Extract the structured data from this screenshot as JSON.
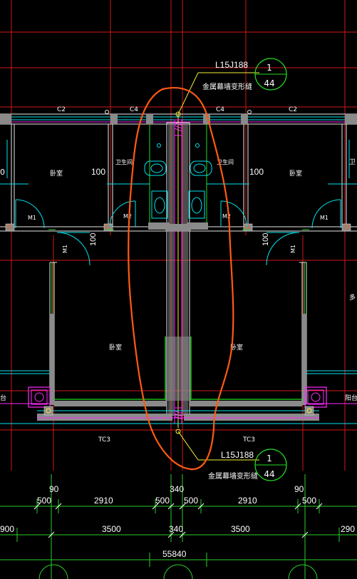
{
  "drawing": {
    "background": "#000000",
    "colors": {
      "axis_red": "#d01818",
      "wall_white": "#e8e8e8",
      "cyan": "#00e5ee",
      "green": "#22dd22",
      "magenta": "#ff2aff",
      "yellow": "#f5f03a",
      "gray_fill": "#8a8a8a",
      "orange_markup": "#ff5a14",
      "dim_green": "#2ad02a",
      "text_white": "#ffffff"
    },
    "top_callout": {
      "ref": "L15J188",
      "circle_top": "1",
      "circle_bottom": "44",
      "label": "金属幕墙变形缝"
    },
    "bottom_callout": {
      "ref": "L15J188",
      "circle_top": "1",
      "circle_bottom": "44",
      "label": "金属幕墙变形缝"
    },
    "window_labels": {
      "c2_left": "C2",
      "c4_left": "C4",
      "c4_right": "C4",
      "c2_right": "C2",
      "tc3_left": "TC3",
      "tc3_right": "TC3"
    },
    "room_labels": {
      "bedroom_tl": "卧室",
      "bedroom_tr": "卧室",
      "bath_left": "卫生间",
      "bath_right": "卫生间",
      "bedroom_ml": "卧室",
      "bedroom_mr": "卧室",
      "balcony_l": "台",
      "balcony_r": "阳台",
      "edge_tl": "0",
      "edge_tr": "卫",
      "edge_mr": "多"
    },
    "door_labels": {
      "m1_left": "M1",
      "m2_left": "M2",
      "m2_right": "M2",
      "m1_right": "M1",
      "m1_vert_left": "M1",
      "m1_vert_right": "M1"
    },
    "misc_dims": {
      "d100_l": "100",
      "d100_r": "100",
      "d100_vl": "100",
      "d100_vr": "100"
    },
    "dimensions": {
      "row1": [
        "90",
        "340",
        "90"
      ],
      "row2": [
        "500",
        "2910",
        "500",
        "500",
        "2910",
        "500"
      ],
      "row3": [
        "900",
        "3500",
        "340",
        "3500",
        "290"
      ],
      "total": "55840"
    }
  }
}
